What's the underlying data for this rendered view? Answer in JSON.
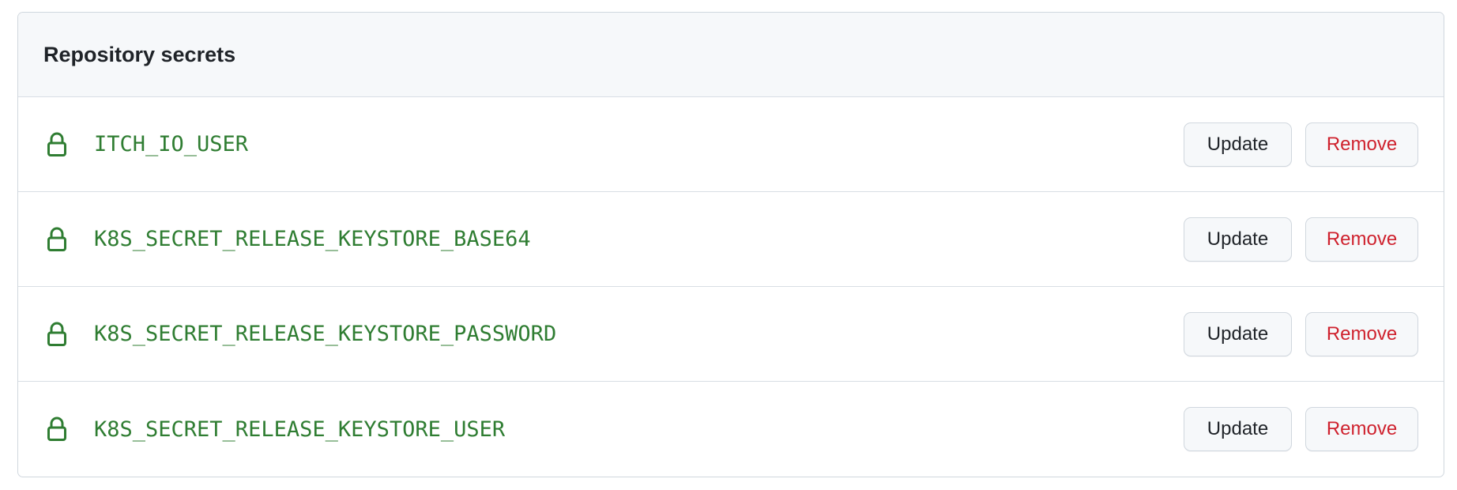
{
  "header": {
    "title": "Repository secrets"
  },
  "colors": {
    "secret_name": "#2f7d32",
    "remove_text": "#cf222e",
    "lock_icon": "#2f7d32"
  },
  "secrets": [
    {
      "name": "ITCH_IO_USER",
      "icon": "lock-icon",
      "update_label": "Update",
      "remove_label": "Remove"
    },
    {
      "name": "K8S_SECRET_RELEASE_KEYSTORE_BASE64",
      "icon": "lock-icon",
      "update_label": "Update",
      "remove_label": "Remove"
    },
    {
      "name": "K8S_SECRET_RELEASE_KEYSTORE_PASSWORD",
      "icon": "lock-icon",
      "update_label": "Update",
      "remove_label": "Remove"
    },
    {
      "name": "K8S_SECRET_RELEASE_KEYSTORE_USER",
      "icon": "lock-icon",
      "update_label": "Update",
      "remove_label": "Remove"
    }
  ]
}
